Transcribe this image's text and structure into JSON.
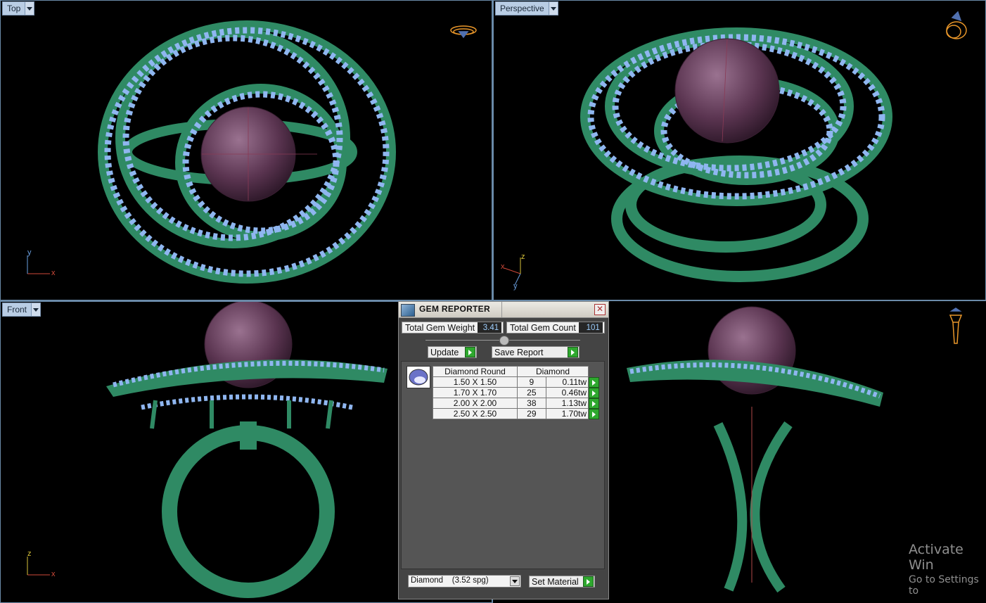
{
  "viewports": {
    "top": {
      "label": "Top",
      "axis_a": "y",
      "axis_b": "x"
    },
    "perspective": {
      "label": "Perspective",
      "axis_a": "z",
      "axis_b": "x",
      "axis_c": "y"
    },
    "front": {
      "label": "Front",
      "axis_a": "z",
      "axis_b": "x"
    },
    "right": {
      "label": ""
    }
  },
  "gem_reporter": {
    "title": "GEM REPORTER",
    "total_gem_weight_label": "Total Gem Weight",
    "total_gem_weight": "3.41",
    "total_gem_count_label": "Total Gem Count",
    "total_gem_count": "101",
    "update_label": "Update",
    "save_report_label": "Save Report",
    "table": {
      "headers": [
        "Diamond Round",
        "Diamond"
      ],
      "rows": [
        {
          "size": "1.50 X 1.50",
          "count": "9",
          "weight": "0.11tw"
        },
        {
          "size": "1.70 X 1.70",
          "count": "25",
          "weight": "0.46tw"
        },
        {
          "size": "2.00 X 2.00",
          "count": "38",
          "weight": "1.13tw"
        },
        {
          "size": "2.50 X 2.50",
          "count": "29",
          "weight": "1.70tw"
        }
      ]
    },
    "material_value": "Diamond    (3.52 spg)",
    "set_material_label": "Set Material"
  },
  "watermark": {
    "line1": "Activate Win",
    "line2": "Go to Settings to"
  },
  "colors": {
    "metal": "#2f8a64",
    "gem": "#8fb6f0",
    "pearl": "#5e3a54",
    "label_bg": "#b9cde4"
  }
}
